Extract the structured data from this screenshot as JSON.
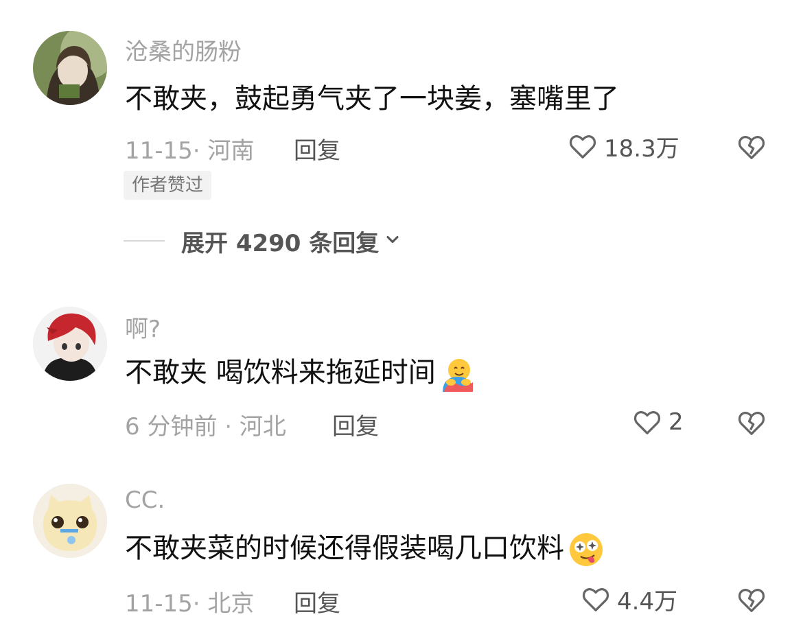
{
  "comments": [
    {
      "username": "沧桑的肠粉",
      "text": "不敢夹，鼓起勇气夹了一块姜，塞嘴里了",
      "meta": "11-15· 河南",
      "reply_label": "回复",
      "likes": "18.3万",
      "author_badge": "作者赞过",
      "expand_label": "展开 4290 条回复"
    },
    {
      "username": "啊?",
      "text": "不敢夹 喝饮料来拖延时间",
      "emoji": "hugging-face-emoji",
      "meta": "6 分钟前 · 河北",
      "reply_label": "回复",
      "likes": "2"
    },
    {
      "username": "CC.",
      "text": "不敢夹菜的时候还得假装喝几口饮料",
      "emoji": "woozy-star-eyes-emoji",
      "meta": "11-15· 北京",
      "reply_label": "回复",
      "likes": "4.4万"
    }
  ],
  "icons": {
    "like": "heart-outline-icon",
    "dislike": "broken-heart-icon",
    "expand": "chevron-down-icon"
  }
}
